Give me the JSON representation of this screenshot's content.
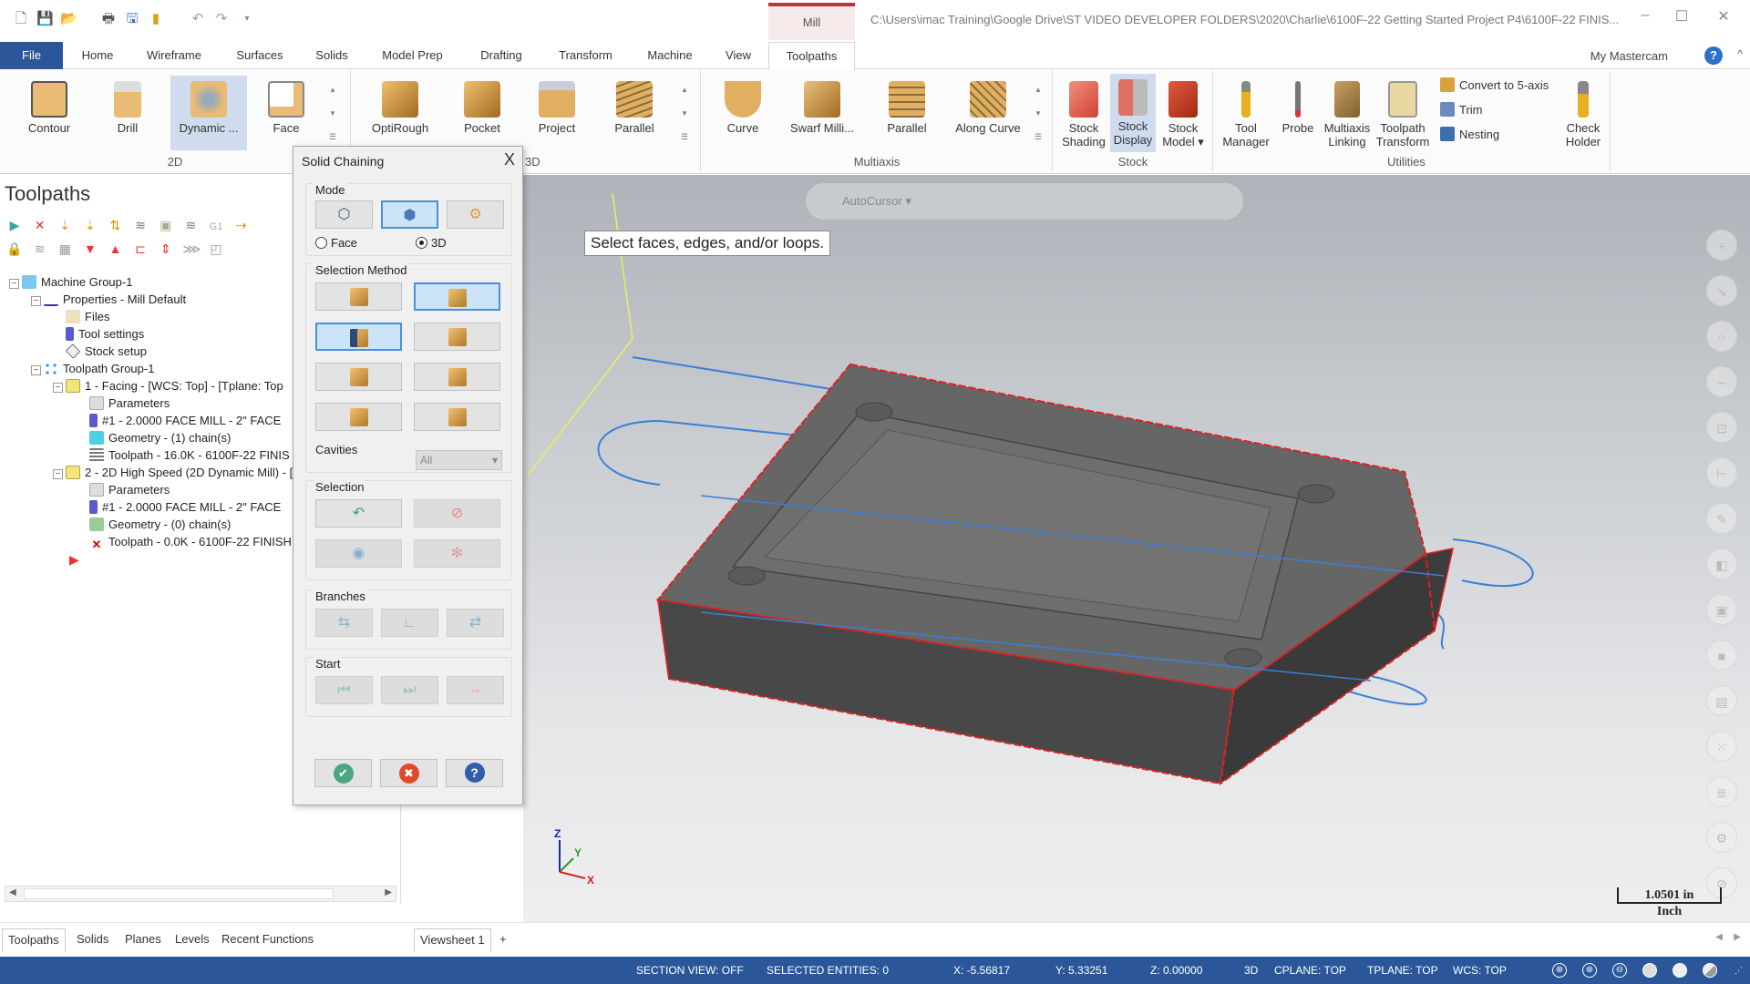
{
  "titlebar": {
    "context_tab": "Mill",
    "path": "C:\\Users\\imac Training\\Google Drive\\ST VIDEO DEVELOPER FOLDERS\\2020\\Charlie\\6100F-22 Getting Started Project P4\\6100F-22 FINIS...",
    "quick_access": [
      "new-icon",
      "save-icon",
      "open-icon",
      "print-icon",
      "save-as-icon",
      "mastercam-folder-icon",
      "undo-icon",
      "redo-icon",
      "customize-icon"
    ],
    "window_controls": {
      "minimize": "–",
      "maximize": "☐",
      "close": "✕"
    }
  },
  "ribbon_tabs": {
    "items": [
      "File",
      "Home",
      "Wireframe",
      "Surfaces",
      "Solids",
      "Model Prep",
      "Drafting",
      "Transform",
      "Machine",
      "View",
      "Toolpaths"
    ],
    "active": "Toolpaths",
    "my_mastercam": "My Mastercam",
    "help": "?",
    "collapse": "^"
  },
  "ribbon": {
    "groups": [
      {
        "label": "2D",
        "buttons": [
          "Contour",
          "Drill",
          "Dynamic ...",
          "Face"
        ],
        "selected": "Dynamic ..."
      },
      {
        "label": "3D",
        "buttons": [
          "OptiRough",
          "Pocket",
          "Project",
          "Parallel"
        ]
      },
      {
        "label": "Multiaxis",
        "buttons": [
          "Curve",
          "Swarf Milli...",
          "Parallel",
          "Along Curve"
        ]
      },
      {
        "label": "Stock",
        "buttons": [
          {
            "l1": "Stock",
            "l2": "Shading"
          },
          {
            "l1": "Stock",
            "l2": "Display"
          },
          {
            "l1": "Stock",
            "l2": "Model ▾"
          }
        ],
        "selected": "Stock Display"
      },
      {
        "label": "Utilities",
        "buttons": [
          {
            "l1": "Tool",
            "l2": "Manager"
          },
          {
            "l1": "Probe",
            "l2": ""
          },
          {
            "l1": "Multiaxis",
            "l2": "Linking"
          },
          {
            "l1": "Toolpath",
            "l2": "Transform"
          },
          {
            "l1": "Check",
            "l2": "Holder"
          }
        ],
        "small_commands": [
          "Convert to 5-axis",
          "Trim",
          "Nesting"
        ]
      }
    ]
  },
  "left_panel": {
    "title": "Toolpaths",
    "tree": [
      {
        "label": "Machine Group-1",
        "level": 0,
        "expander": "−",
        "icon": "machine-group-icon"
      },
      {
        "label": "Properties - Mill Default",
        "level": 1,
        "expander": "−",
        "icon": "properties-icon"
      },
      {
        "label": "Files",
        "level": 2,
        "icon": "folder-icon"
      },
      {
        "label": "Tool settings",
        "level": 2,
        "icon": "tool-icon"
      },
      {
        "label": "Stock setup",
        "level": 2,
        "icon": "stock-icon"
      },
      {
        "label": "Toolpath Group-1",
        "level": 1,
        "expander": "−",
        "icon": "toolpath-group-icon"
      },
      {
        "label": "1 - Facing - [WCS: Top] - [Tplane: Top",
        "level": 2,
        "expander": "−",
        "icon": "operation-folder-icon"
      },
      {
        "label": "Parameters",
        "level": 3,
        "icon": "parameters-icon"
      },
      {
        "label": "#1 - 2.0000 FACE MILL - 2\" FACE",
        "level": 3,
        "icon": "tool-icon"
      },
      {
        "label": "Geometry - (1) chain(s)",
        "level": 3,
        "icon": "geometry-icon"
      },
      {
        "label": "Toolpath - 16.0K - 6100F-22 FINIS",
        "level": 3,
        "icon": "toolpath-icon"
      },
      {
        "label": "2 - 2D High Speed (2D Dynamic Mill) - [",
        "level": 2,
        "expander": "−",
        "icon": "operation-folder-icon"
      },
      {
        "label": "Parameters",
        "level": 3,
        "icon": "parameters-icon"
      },
      {
        "label": "#1 - 2.0000 FACE MILL - 2\" FACE",
        "level": 3,
        "icon": "tool-icon"
      },
      {
        "label": "Geometry - (0) chain(s)",
        "level": 3,
        "icon": "geometry-icon"
      },
      {
        "label": "Toolpath - 0.0K - 6100F-22 FINISH",
        "level": 3,
        "icon": "dirty-toolpath-icon"
      }
    ]
  },
  "dialog": {
    "title": "Solid Chaining",
    "close": "X",
    "mode": {
      "label": "Mode",
      "radio_face": "Face",
      "radio_3d": "3D",
      "selected": "3D"
    },
    "selection_method": {
      "label": "Selection Method",
      "cavities_label": "Cavities",
      "cavities_value": "All"
    },
    "selection": {
      "label": "Selection"
    },
    "branches": {
      "label": "Branches"
    },
    "start": {
      "label": "Start"
    },
    "footer": {
      "ok": "✔",
      "cancel": "✖",
      "help": "?"
    }
  },
  "viewport": {
    "prompt": "Select faces, edges, and/or loops.",
    "autocursor": "AutoCursor",
    "scale": {
      "value": "1.0501 in",
      "unit": "Inch"
    },
    "axes": {
      "x": "X",
      "y": "Y",
      "z": "Z"
    }
  },
  "bottom_tabs": {
    "panel_tabs": [
      "Toolpaths",
      "Solids",
      "Planes",
      "Levels",
      "Recent Functions"
    ],
    "active": "Toolpaths",
    "viewsheet": "Viewsheet 1",
    "add": "+"
  },
  "statusbar": {
    "section_view": "SECTION VIEW: OFF",
    "selected": "SELECTED ENTITIES: 0",
    "x": "X:  -5.56817",
    "y": "Y:  5.33251",
    "z": "Z:  0.00000",
    "mode": "3D",
    "cplane": "CPLANE: TOP",
    "tplane": "TPLANE: TOP",
    "wcs": "WCS: TOP"
  },
  "colors": {
    "accent": "#2b579a",
    "context_tab": "#c0333a",
    "selection_edge": "#e02020",
    "chain_blue": "#3a7fd8"
  }
}
